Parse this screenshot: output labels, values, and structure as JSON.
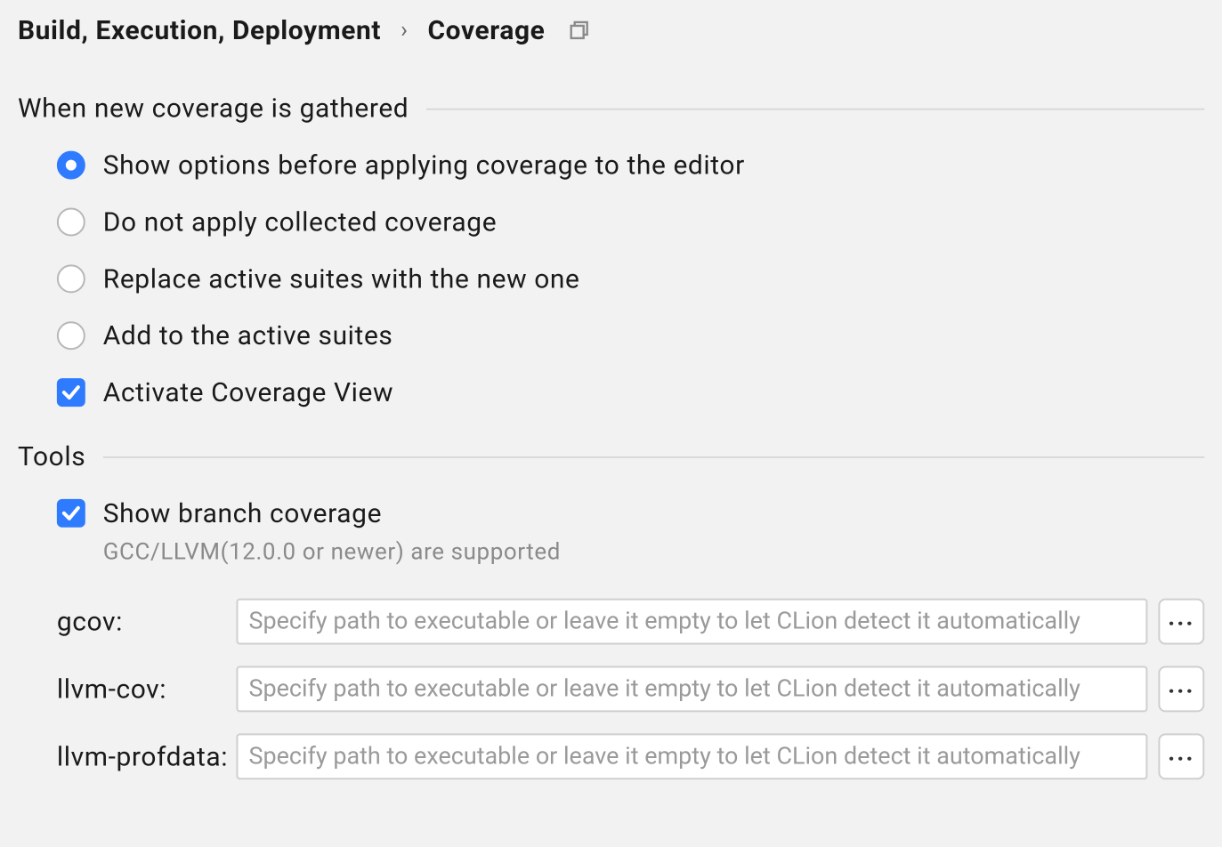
{
  "breadcrumb": {
    "parent": "Build, Execution, Deployment",
    "current": "Coverage"
  },
  "sections": {
    "gather": {
      "title": "When new coverage is gathered",
      "radios": [
        {
          "label": "Show options before applying coverage to the editor",
          "selected": true
        },
        {
          "label": "Do not apply collected coverage",
          "selected": false
        },
        {
          "label": "Replace active suites with the new one",
          "selected": false
        },
        {
          "label": "Add to the active suites",
          "selected": false
        }
      ],
      "activate_view": {
        "label": "Activate Coverage View",
        "checked": true
      }
    },
    "tools": {
      "title": "Tools",
      "show_branch": {
        "label": "Show branch coverage",
        "hint": "GCC/LLVM(12.0.0 or newer) are supported",
        "checked": true
      },
      "paths": [
        {
          "key": "gcov",
          "label": "gcov:",
          "value": "",
          "placeholder": "Specify path to executable or leave it empty to let CLion detect it automatically"
        },
        {
          "key": "llvm_cov",
          "label": "llvm-cov:",
          "value": "",
          "placeholder": "Specify path to executable or leave it empty to let CLion detect it automatically"
        },
        {
          "key": "llvm_profdata",
          "label": "llvm-profdata:",
          "value": "",
          "placeholder": "Specify path to executable or leave it empty to let CLion detect it automatically"
        }
      ],
      "browse_label": "..."
    }
  }
}
